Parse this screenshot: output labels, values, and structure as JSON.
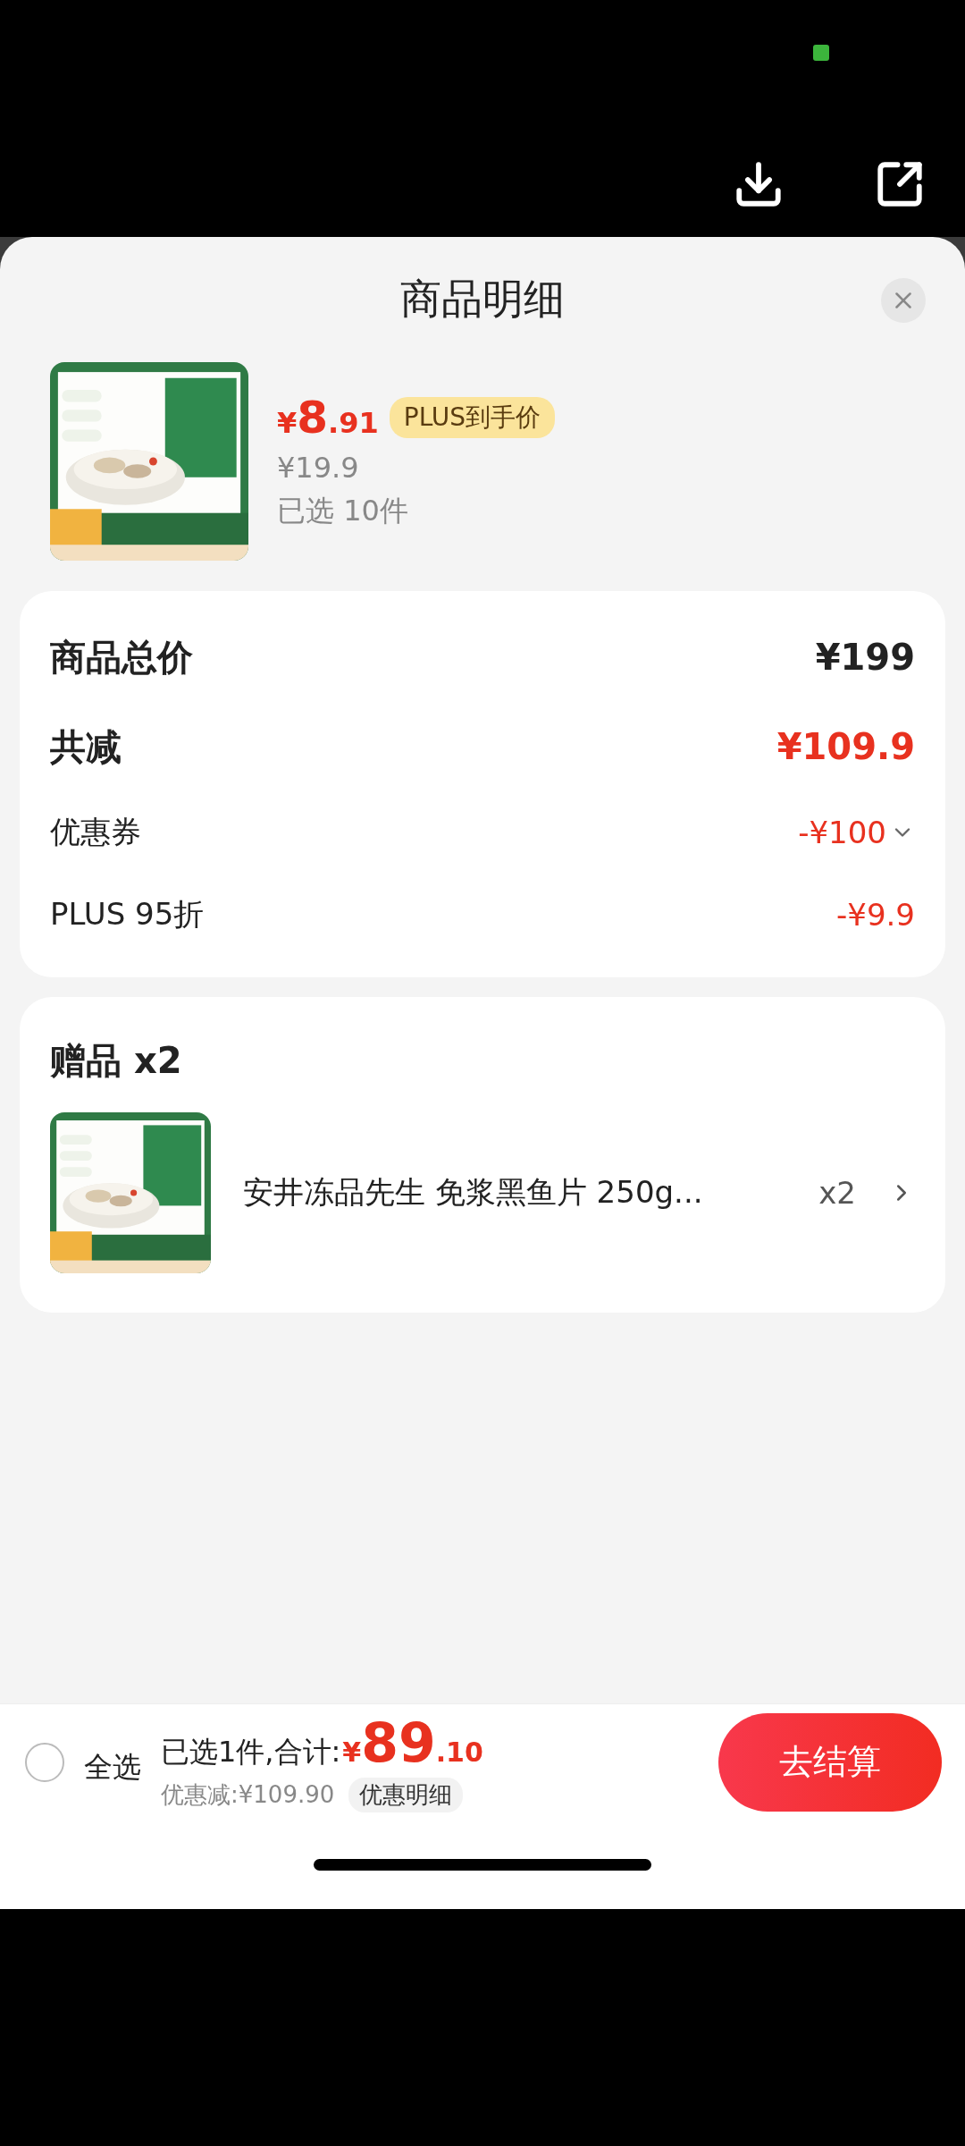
{
  "sheet": {
    "title": "商品明细"
  },
  "product": {
    "currency": "¥",
    "price_integer": "8",
    "price_decimal": ".91",
    "price_tag": "PLUS到手价",
    "original_price": "¥19.9",
    "selected_count": "已选 10件"
  },
  "summary": {
    "rows": [
      {
        "kind": "total",
        "label": "商品总价",
        "value": "¥199"
      },
      {
        "kind": "reduction",
        "label": "共减",
        "value": "¥109.9"
      },
      {
        "kind": "coupon",
        "label": "优惠券",
        "value": "-¥100"
      },
      {
        "kind": "discount",
        "label": "PLUS 95折",
        "value": "-¥9.9"
      }
    ]
  },
  "gifts": {
    "title": "赠品 x2",
    "items": [
      {
        "name": "安井冻品先生 免浆黑鱼片 250g...",
        "quantity": "x2"
      }
    ]
  },
  "checkout_bar": {
    "select_all": {
      "label": "全选",
      "checked": false
    },
    "summary_label": "已选1件,合计:",
    "currency": "¥",
    "total_integer": "89",
    "total_decimal": ".10",
    "savings": "优惠减:¥109.90",
    "details_button": "优惠明细",
    "checkout_button": "去结算"
  }
}
